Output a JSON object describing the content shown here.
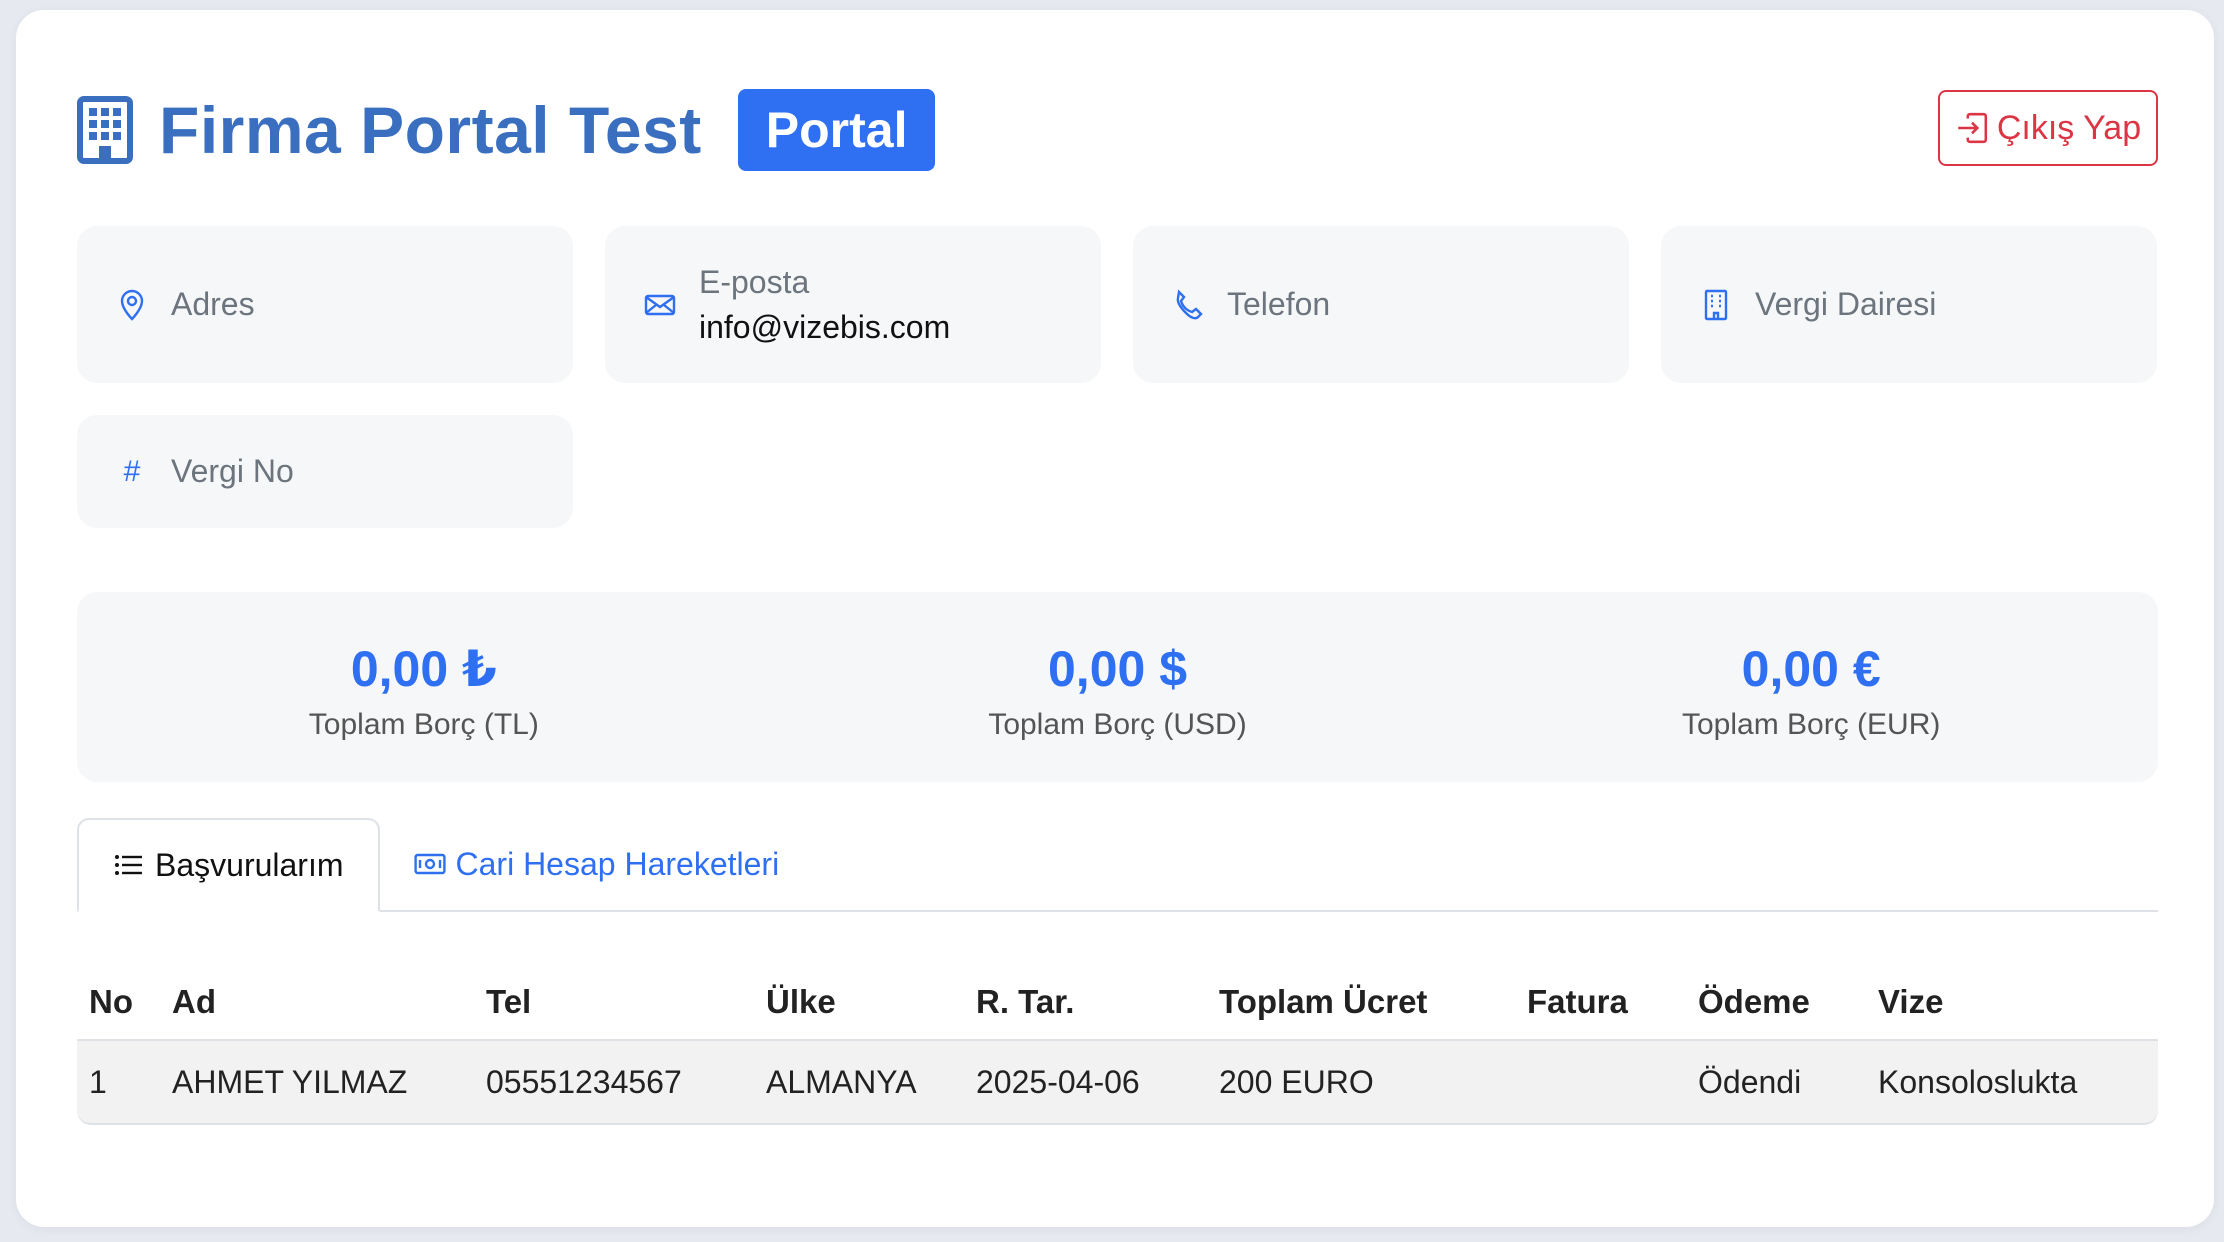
{
  "header": {
    "title": "Firma Portal Test",
    "badge": "Portal",
    "logout_label": "Çıkış Yap"
  },
  "info": {
    "address_label": "Adres",
    "email_label": "E-posta",
    "email_value": "info@vizebis.com",
    "phone_label": "Telefon",
    "tax_office_label": "Vergi Dairesi",
    "tax_no_icon": "#",
    "tax_no_label": "Vergi No"
  },
  "totals": [
    {
      "value": "0,00 ₺",
      "label": "Toplam Borç (TL)"
    },
    {
      "value": "0,00 $",
      "label": "Toplam Borç (USD)"
    },
    {
      "value": "0,00 €",
      "label": "Toplam Borç (EUR)"
    }
  ],
  "tabs": [
    {
      "label": "Başvurularım",
      "icon": "list-icon",
      "active": true
    },
    {
      "label": "Cari Hesap Hareketleri",
      "icon": "cash-icon",
      "active": false
    }
  ],
  "table": {
    "columns": [
      "No",
      "Ad",
      "Tel",
      "Ülke",
      "R. Tar.",
      "Toplam Ücret",
      "Fatura",
      "Ödeme",
      "Vize"
    ],
    "rows": [
      [
        "1",
        "AHMET YILMAZ",
        "05551234567",
        "ALMANYA",
        "2025-04-06",
        "200 EURO",
        "",
        "Ödendi",
        "Konsolosluktа"
      ]
    ]
  },
  "colors": {
    "primary": "#2f6ff1",
    "title": "#3a6fc0",
    "danger": "#dc3545",
    "panel": "#f6f7f9"
  }
}
